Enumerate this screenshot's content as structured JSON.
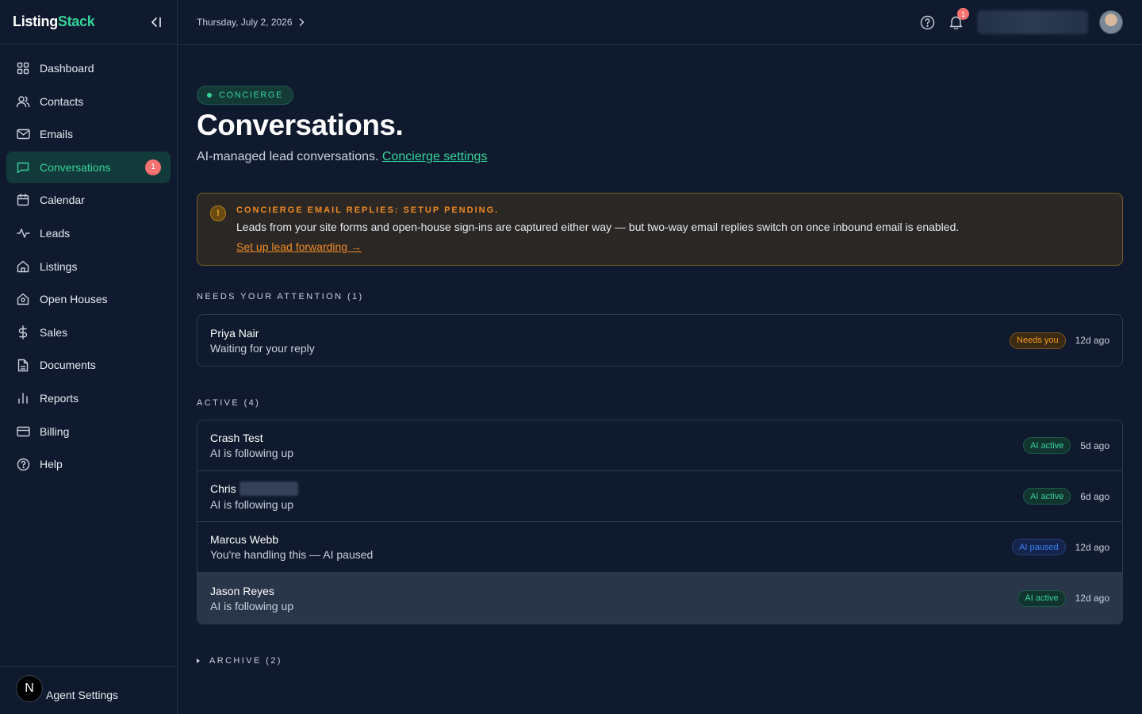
{
  "brand": {
    "part1": "Listing",
    "part2": "Stack"
  },
  "sidebar": {
    "items": [
      {
        "label": "Dashboard",
        "icon": "grid-icon"
      },
      {
        "label": "Contacts",
        "icon": "users-icon"
      },
      {
        "label": "Emails",
        "icon": "mail-icon"
      },
      {
        "label": "Conversations",
        "icon": "chat-icon",
        "badge": "1"
      },
      {
        "label": "Calendar",
        "icon": "calendar-icon"
      },
      {
        "label": "Leads",
        "icon": "activity-icon"
      },
      {
        "label": "Listings",
        "icon": "home-icon"
      },
      {
        "label": "Open Houses",
        "icon": "house-open-icon"
      },
      {
        "label": "Sales",
        "icon": "dollar-icon"
      },
      {
        "label": "Documents",
        "icon": "document-icon"
      },
      {
        "label": "Reports",
        "icon": "bar-chart-icon"
      },
      {
        "label": "Billing",
        "icon": "credit-card-icon"
      },
      {
        "label": "Help",
        "icon": "help-circle-icon"
      }
    ],
    "footer": {
      "avatar_letter": "N",
      "label": "Agent Settings"
    }
  },
  "topbar": {
    "date": "Thursday, July 2, 2026",
    "notifications": "1"
  },
  "main": {
    "pill": "CONCIERGE",
    "title": "Conversations.",
    "subtitle": "AI-managed lead conversations.",
    "subtitle_link": "Concierge settings",
    "alert": {
      "icon": "!",
      "title": "CONCIERGE EMAIL REPLIES: SETUP PENDING.",
      "text": "Leads from your site forms and open-house sign-ins are captured either way — but two-way email replies switch on once inbound email is enabled.",
      "link": "Set up lead forwarding →"
    },
    "needs_label": "NEEDS YOUR ATTENTION (1)",
    "needs": [
      {
        "name": "Priya Nair",
        "status": "Waiting for your reply",
        "tag": "Needs you",
        "time": "12d ago"
      }
    ],
    "active_label": "ACTIVE (4)",
    "active": [
      {
        "name": "Crash Test",
        "status": "AI is following up",
        "tag": "AI active",
        "time": "5d ago"
      },
      {
        "name": "Chris",
        "status": "AI is following up",
        "tag": "AI active",
        "time": "6d ago"
      },
      {
        "name": "Marcus Webb",
        "status": "You're handling this — AI paused",
        "tag": "AI paused",
        "time": "12d ago"
      },
      {
        "name": "Jason Reyes",
        "status": "AI is following up",
        "tag": "AI active",
        "time": "12d ago"
      }
    ],
    "archive_label": "ARCHIVE (2)"
  },
  "colors": {
    "accent": "#34d399",
    "warning": "#f08a24",
    "paused": "#3b82f6",
    "badge": "#f87171"
  }
}
